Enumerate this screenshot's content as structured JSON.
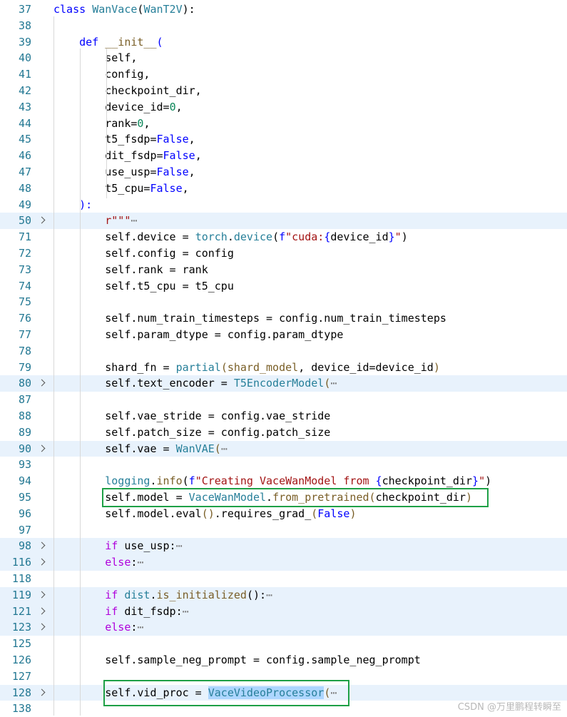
{
  "gutter": {
    "fold_icon": "chevron-right-icon",
    "folded_bg": "#e8f2fc"
  },
  "lines": [
    {
      "n": "37",
      "segs": [
        {
          "t": "class ",
          "c": "kw"
        },
        {
          "t": "WanVace",
          "c": "cls"
        },
        {
          "t": "("
        },
        {
          "t": "WanT2V",
          "c": "cls"
        },
        {
          "t": "):"
        }
      ]
    },
    {
      "n": "38",
      "segs": []
    },
    {
      "n": "39",
      "segs": [
        {
          "t": "    def ",
          "c": "kw"
        },
        {
          "t": "__init__",
          "c": "fn"
        },
        {
          "t": "(",
          "c": "kw"
        }
      ]
    },
    {
      "n": "40",
      "segs": [
        {
          "t": "        self,"
        }
      ]
    },
    {
      "n": "41",
      "segs": [
        {
          "t": "        config,"
        }
      ]
    },
    {
      "n": "42",
      "segs": [
        {
          "t": "        checkpoint_dir,"
        }
      ]
    },
    {
      "n": "43",
      "segs": [
        {
          "t": "        device_id="
        },
        {
          "t": "0",
          "c": "num"
        },
        {
          "t": ","
        }
      ]
    },
    {
      "n": "44",
      "segs": [
        {
          "t": "        rank="
        },
        {
          "t": "0",
          "c": "num"
        },
        {
          "t": ","
        }
      ]
    },
    {
      "n": "45",
      "segs": [
        {
          "t": "        t5_fsdp="
        },
        {
          "t": "False",
          "c": "kw"
        },
        {
          "t": ","
        }
      ]
    },
    {
      "n": "46",
      "segs": [
        {
          "t": "        dit_fsdp="
        },
        {
          "t": "False",
          "c": "kw"
        },
        {
          "t": ","
        }
      ]
    },
    {
      "n": "47",
      "segs": [
        {
          "t": "        use_usp="
        },
        {
          "t": "False",
          "c": "kw"
        },
        {
          "t": ","
        }
      ]
    },
    {
      "n": "48",
      "segs": [
        {
          "t": "        t5_cpu="
        },
        {
          "t": "False",
          "c": "kw"
        },
        {
          "t": ","
        }
      ]
    },
    {
      "n": "49",
      "segs": [
        {
          "t": "    ):",
          "c": "kw"
        }
      ]
    },
    {
      "n": "50",
      "folded": true,
      "segs": [
        {
          "t": "        r\"\"\"",
          "c": "str"
        },
        {
          "t": "⋯",
          "c": "ell"
        }
      ]
    },
    {
      "n": "71",
      "segs": [
        {
          "t": "        self.device = "
        },
        {
          "t": "torch",
          "c": "cls"
        },
        {
          "t": "."
        },
        {
          "t": "device",
          "c": "cls"
        },
        {
          "t": "("
        },
        {
          "t": "f",
          "c": "strp"
        },
        {
          "t": "\"cuda:",
          "c": "str"
        },
        {
          "t": "{",
          "c": "strp"
        },
        {
          "t": "device_id"
        },
        {
          "t": "}",
          "c": "strp"
        },
        {
          "t": "\"",
          "c": "str"
        },
        {
          "t": ")"
        }
      ]
    },
    {
      "n": "72",
      "segs": [
        {
          "t": "        self.config = config"
        }
      ]
    },
    {
      "n": "73",
      "segs": [
        {
          "t": "        self.rank = rank"
        }
      ]
    },
    {
      "n": "74",
      "segs": [
        {
          "t": "        self.t5_cpu = t5_cpu"
        }
      ]
    },
    {
      "n": "75",
      "segs": []
    },
    {
      "n": "76",
      "segs": [
        {
          "t": "        self.num_train_timesteps = config.num_train_timesteps"
        }
      ]
    },
    {
      "n": "77",
      "segs": [
        {
          "t": "        self.param_dtype = config.param_dtype"
        }
      ]
    },
    {
      "n": "78",
      "segs": []
    },
    {
      "n": "79",
      "segs": [
        {
          "t": "        shard_fn = "
        },
        {
          "t": "partial",
          "c": "cls"
        },
        {
          "t": "(",
          "c": "fn"
        },
        {
          "t": "shard_model",
          "c": "fn"
        },
        {
          "t": ", device_id=device_id"
        },
        {
          "t": ")",
          "c": "fn"
        }
      ]
    },
    {
      "n": "80",
      "folded": true,
      "segs": [
        {
          "t": "        self.text_encoder = "
        },
        {
          "t": "T5EncoderModel",
          "c": "cls"
        },
        {
          "t": "(",
          "c": "fn"
        },
        {
          "t": "⋯",
          "c": "ell"
        }
      ]
    },
    {
      "n": "87",
      "segs": []
    },
    {
      "n": "88",
      "segs": [
        {
          "t": "        self.vae_stride = config.vae_stride"
        }
      ]
    },
    {
      "n": "89",
      "segs": [
        {
          "t": "        self.patch_size = config.patch_size"
        }
      ]
    },
    {
      "n": "90",
      "folded": true,
      "segs": [
        {
          "t": "        self.vae = "
        },
        {
          "t": "WanVAE",
          "c": "cls"
        },
        {
          "t": "(",
          "c": "fn"
        },
        {
          "t": "⋯",
          "c": "ell"
        }
      ]
    },
    {
      "n": "93",
      "segs": []
    },
    {
      "n": "94",
      "segs": [
        {
          "t": "        "
        },
        {
          "t": "logging",
          "c": "cls"
        },
        {
          "t": "."
        },
        {
          "t": "info",
          "c": "fn"
        },
        {
          "t": "("
        },
        {
          "t": "f",
          "c": "strp"
        },
        {
          "t": "\"Creating VaceWanModel from ",
          "c": "str"
        },
        {
          "t": "{",
          "c": "strp"
        },
        {
          "t": "checkpoint_dir"
        },
        {
          "t": "}",
          "c": "strp"
        },
        {
          "t": "\"",
          "c": "str"
        },
        {
          "t": ")"
        }
      ]
    },
    {
      "n": "95",
      "segs": [
        {
          "t": "        self.model = "
        },
        {
          "t": "VaceWanModel",
          "c": "cls"
        },
        {
          "t": "."
        },
        {
          "t": "from_pretrained",
          "c": "fn"
        },
        {
          "t": "(",
          "c": "fn"
        },
        {
          "t": "checkpoint_dir"
        },
        {
          "t": ")",
          "c": "fn"
        }
      ]
    },
    {
      "n": "96",
      "segs": [
        {
          "t": "        self.model.eval"
        },
        {
          "t": "()",
          "c": "fn"
        },
        {
          "t": ".requires_grad_"
        },
        {
          "t": "(",
          "c": "fn"
        },
        {
          "t": "False",
          "c": "kw"
        },
        {
          "t": ")",
          "c": "fn"
        }
      ]
    },
    {
      "n": "97",
      "segs": []
    },
    {
      "n": "98",
      "folded": true,
      "segs": [
        {
          "t": "        "
        },
        {
          "t": "if",
          "c": "ctl"
        },
        {
          "t": " use_usp:"
        },
        {
          "t": "⋯",
          "c": "ell"
        }
      ]
    },
    {
      "n": "116",
      "folded": true,
      "segs": [
        {
          "t": "        "
        },
        {
          "t": "else",
          "c": "ctl"
        },
        {
          "t": ":"
        },
        {
          "t": "⋯",
          "c": "ell"
        }
      ]
    },
    {
      "n": "118",
      "segs": []
    },
    {
      "n": "119",
      "folded": true,
      "segs": [
        {
          "t": "        "
        },
        {
          "t": "if",
          "c": "ctl"
        },
        {
          "t": " "
        },
        {
          "t": "dist",
          "c": "cls"
        },
        {
          "t": "."
        },
        {
          "t": "is_initialized",
          "c": "fn"
        },
        {
          "t": "():"
        },
        {
          "t": "⋯",
          "c": "ell"
        }
      ]
    },
    {
      "n": "121",
      "folded": true,
      "segs": [
        {
          "t": "        "
        },
        {
          "t": "if",
          "c": "ctl"
        },
        {
          "t": " dit_fsdp:"
        },
        {
          "t": "⋯",
          "c": "ell"
        }
      ]
    },
    {
      "n": "123",
      "folded": true,
      "segs": [
        {
          "t": "        "
        },
        {
          "t": "else",
          "c": "ctl"
        },
        {
          "t": ":"
        },
        {
          "t": "⋯",
          "c": "ell"
        }
      ]
    },
    {
      "n": "125",
      "segs": []
    },
    {
      "n": "126",
      "segs": [
        {
          "t": "        self.sample_neg_prompt = config.sample_neg_prompt"
        }
      ]
    },
    {
      "n": "127",
      "segs": []
    },
    {
      "n": "128",
      "folded": true,
      "segs": [
        {
          "t": "        self.vid_proc = "
        },
        {
          "t": "VaceVideoProcessor",
          "c": "cls hl"
        },
        {
          "t": "(",
          "c": "fn"
        },
        {
          "t": "⋯",
          "c": "ell"
        }
      ]
    },
    {
      "n": "138",
      "segs": []
    }
  ],
  "highlight_boxes": [
    {
      "line": "95",
      "color": "#1ea046"
    },
    {
      "line": "128",
      "color": "#1ea046"
    }
  ],
  "watermark": "CSDN @万里鹏程转瞬至"
}
